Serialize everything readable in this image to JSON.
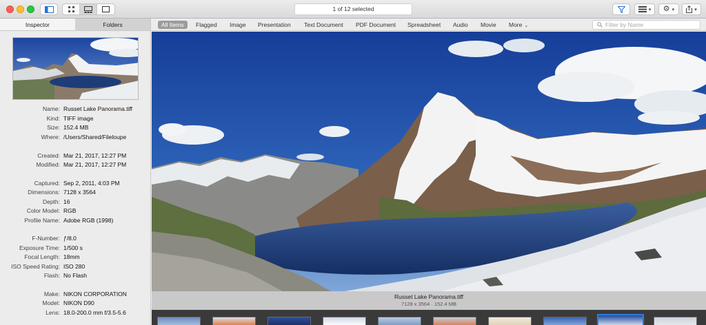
{
  "toolbar": {
    "status_text": "1 of 12 selected",
    "icons": [
      "sidebar-icon",
      "grid-view-icon",
      "filmstrip-view-icon",
      "single-view-icon",
      "filter-icon",
      "arrange-icon",
      "gear-icon",
      "share-icon"
    ],
    "window_controls": [
      "close",
      "minimize",
      "zoom"
    ]
  },
  "left_tabs": {
    "inspector": "Inspector",
    "folders": "Folders"
  },
  "metadata": [
    {
      "key": "Name:",
      "value": "Russet Lake Panorama.tiff"
    },
    {
      "key": "Kind:",
      "value": "TIFF image"
    },
    {
      "key": "Size:",
      "value": "152.4 MB"
    },
    {
      "key": "Where:",
      "value": "/Users/Shared/Fileloupe"
    },
    {
      "key": "Created:",
      "value": "Mar 21, 2017, 12:27 PM"
    },
    {
      "key": "Modified:",
      "value": "Mar 21, 2017, 12:27 PM"
    },
    {
      "key": "Captured:",
      "value": "Sep 2, 2011, 4:03 PM"
    },
    {
      "key": "Dimensions:",
      "value": "7128 x 3564"
    },
    {
      "key": "Depth:",
      "value": "16"
    },
    {
      "key": "Color Model:",
      "value": "RGB"
    },
    {
      "key": "Profile Name:",
      "value": "Adobe RGB (1998)"
    },
    {
      "key": "F-Number:",
      "value": "ƒ/8.0"
    },
    {
      "key": "Exposure Time:",
      "value": "1/500 s"
    },
    {
      "key": "Focal Length:",
      "value": "18mm"
    },
    {
      "key": "ISO Speed Rating:",
      "value": "ISO 280"
    },
    {
      "key": "Flash:",
      "value": "No Flash"
    },
    {
      "key": "Make:",
      "value": "NIKON CORPORATION"
    },
    {
      "key": "Model:",
      "value": "NIKON D90"
    },
    {
      "key": "Lens:",
      "value": "18.0-200.0 mm f/3.5-5.6"
    }
  ],
  "filters": [
    "All Items",
    "Flagged",
    "Image",
    "Presentation",
    "Text Document",
    "PDF Document",
    "Spreadsheet",
    "Audio",
    "Movie",
    "More"
  ],
  "filters_active": "All Items",
  "search": {
    "placeholder": "Filter by Name"
  },
  "caption": {
    "name": "Russet Lake Panorama.tiff",
    "info": "7128 x 3564 · 152.4 MB"
  },
  "filmstrip": {
    "count": 9,
    "selected_index": 8
  },
  "colors": {
    "accent": "#2e7de2",
    "sky": "#1f4fa3",
    "lake": "#1e3f7c"
  }
}
